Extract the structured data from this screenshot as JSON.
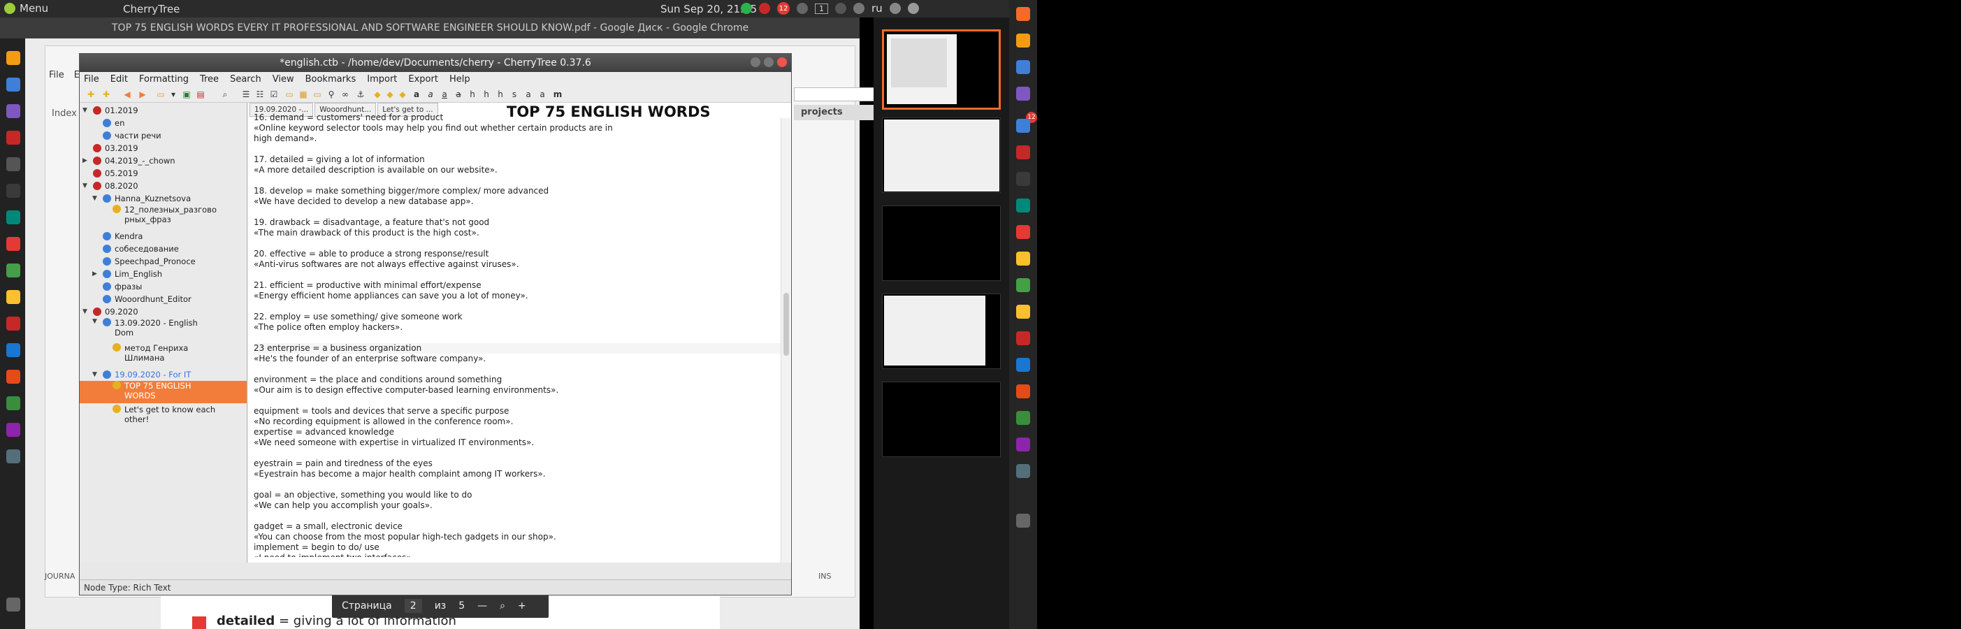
{
  "top_panel": {
    "menu_label": "Menu",
    "app_name": "CherryTree",
    "clock": "Sun Sep 20, 21:05",
    "language": "ru",
    "notification_count": "12",
    "workspace_number": "1"
  },
  "chrome": {
    "title": "TOP 75 ENGLISH WORDS EVERY IT PROFESSIONAL AND SOFTWARE ENGINEER SHOULD KNOW.pdf - Google Диск - Google Chrome",
    "file_menu": [
      "File",
      "Ed"
    ],
    "index_label": "Index",
    "projects_label": "projects",
    "journal_label": "JOURNA",
    "ins_label": "INS"
  },
  "pdf_viewer": {
    "page_label": "Страница",
    "page_current": "2",
    "page_of": "из",
    "page_total": "5",
    "preview_term": "detailed",
    "preview_text": " = giving a lot of information"
  },
  "cherrytree": {
    "title": "*english.ctb - /home/dev/Documents/cherry - CherryTree 0.37.6",
    "menu": [
      "File",
      "Edit",
      "Formatting",
      "Tree",
      "Search",
      "View",
      "Bookmarks",
      "Import",
      "Export",
      "Help"
    ],
    "tabs": [
      "19.09.2020 -...",
      "Wooordhunt...",
      "Let's get to ..."
    ],
    "node_title": "TOP 75 ENGLISH WORDS",
    "status": "Node Type: Rich Text",
    "tree": [
      {
        "label": "01.2019",
        "color": "red",
        "arrow": "▼"
      },
      {
        "label": "en",
        "color": "blue",
        "arrow": ""
      },
      {
        "label": "части речи",
        "color": "blue",
        "arrow": ""
      },
      {
        "label": "03.2019",
        "color": "red",
        "arrow": ""
      },
      {
        "label": "04.2019_-_chown",
        "color": "red",
        "arrow": "▶"
      },
      {
        "label": "05.2019",
        "color": "red",
        "arrow": ""
      },
      {
        "label": "08.2020",
        "color": "red",
        "arrow": "▼"
      },
      {
        "label": "Hanna_Kuznetsova",
        "color": "blue",
        "arrow": "▼"
      },
      {
        "label": "12_полезных_разгово",
        "label2": "рных_фраз",
        "color": "yellow",
        "arrow": ""
      },
      {
        "label": "Kendra",
        "color": "blue",
        "arrow": ""
      },
      {
        "label": "собеседование",
        "color": "blue",
        "arrow": ""
      },
      {
        "label": "Speechpad_Pronoce",
        "color": "blue",
        "arrow": ""
      },
      {
        "label": "Lim_English",
        "color": "blue",
        "arrow": "▶"
      },
      {
        "label": "фразы",
        "color": "blue",
        "arrow": ""
      },
      {
        "label": "Wooordhunt_Editor",
        "color": "blue",
        "arrow": ""
      },
      {
        "label": "09.2020",
        "color": "red",
        "arrow": "▼"
      },
      {
        "label": "13.09.2020 - English",
        "label2": "Dom",
        "color": "blue",
        "arrow": "▼"
      },
      {
        "label": "метод Генриха",
        "label2": "Шлимана",
        "color": "yellow",
        "arrow": ""
      },
      {
        "label": "19.09.2020 - For IT",
        "color": "blue",
        "arrow": "▼"
      },
      {
        "label": "TOP 75 ENGLISH",
        "label2": "WORDS",
        "color": "yellow",
        "arrow": ""
      },
      {
        "label": "Let's get to know each",
        "label2": "other!",
        "color": "yellow",
        "arrow": ""
      }
    ],
    "text_lines": [
      "16. demand = customers' need for a product",
      "«Online keyword selector tools may help you find out whether certain products are in",
      "high demand».",
      "",
      "17. detailed = giving a lot of information",
      "«A more detailed description is available on our website».",
      "",
      "18. develop = make something bigger/more complex/ more advanced",
      "«We have decided to develop a new database app».",
      "",
      "19. drawback = disadvantage, a feature that's not good",
      "«The main drawback of this product is the high cost».",
      "",
      "20. effective = able to produce a strong response/result",
      "«Anti-virus softwares are not always effective against viruses».",
      "",
      "21. efficient = productive with minimal effort/expense",
      "«Energy efficient home appliances can save you a lot of money».",
      "",
      "22. employ = use something/ give someone work",
      "«The police often employ hackers».",
      "",
      "23 enterprise = a business organization",
      "«He's the founder of an enterprise software company».",
      "",
      "environment = the place and conditions around something",
      "«Our aim is to design effective computer-based learning environments».",
      "",
      "equipment = tools and devices that serve a specific purpose",
      "«No recording equipment is allowed in the conference room».",
      "expertise = advanced knowledge",
      "«We need someone with expertise in virtualized IT environments».",
      "",
      "eyestrain = pain and tiredness of the eyes",
      "«Eyestrain has become a major health complaint among IT workers».",
      "",
      "goal = an objective, something you would like to do",
      "«We can help you accomplish your goals».",
      "",
      "gadget = a small, electronic device",
      "«You can choose from the most popular high-tech gadgets in our shop».",
      "implement = begin to do/ use",
      "«I need to implement two interfaces»."
    ]
  },
  "colors": {
    "selected_node": "#f27d3a",
    "active_workspace": "#f26b2a",
    "cherry_red": "#c62828",
    "cherry_blue": "#3f7fd8",
    "cherry_yellow": "#e6b020"
  }
}
